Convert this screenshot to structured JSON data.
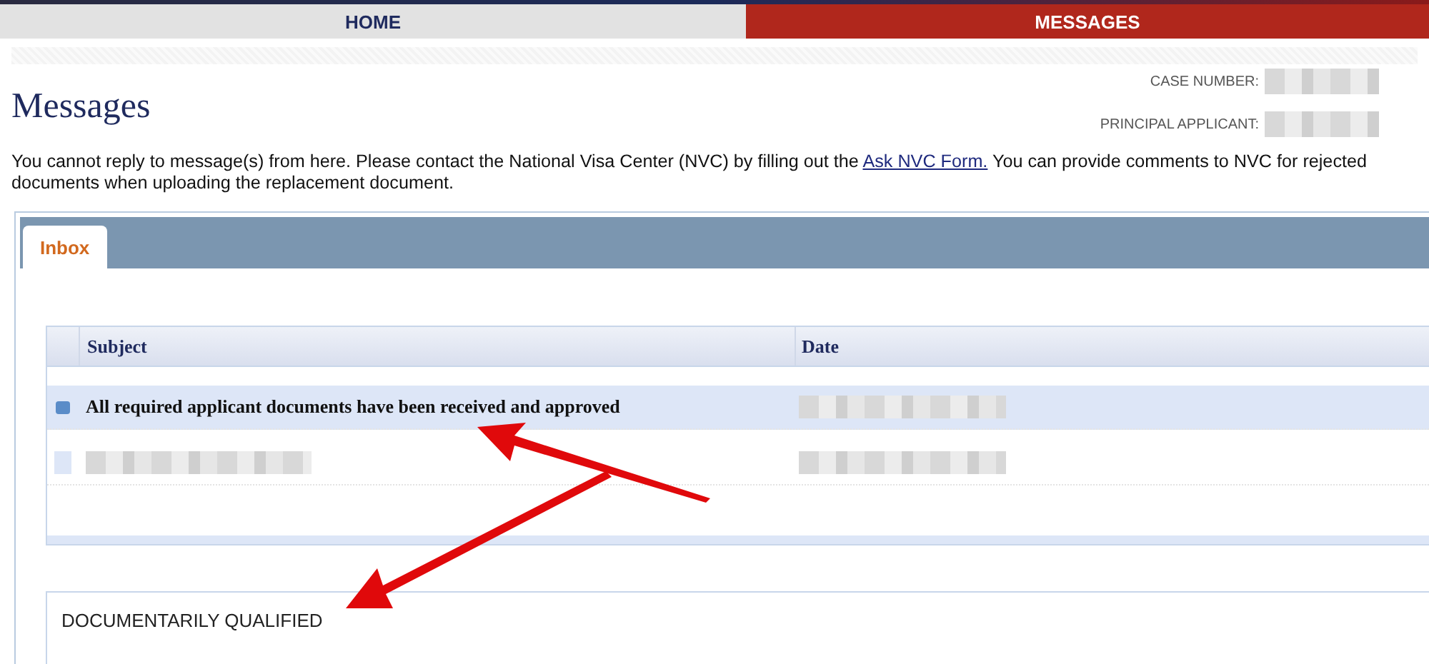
{
  "nav": [
    {
      "label": "HOME",
      "selected": false
    },
    {
      "label": "MESSAGES",
      "selected": true
    }
  ],
  "case_info": [
    {
      "label": "CASE NUMBER:",
      "kind": "redacted"
    },
    {
      "label": "PRINCIPAL APPLICANT:",
      "kind": "redacted"
    }
  ],
  "page_title": "Messages",
  "notice": {
    "before": "You cannot reply to message(s) from here.  Please contact the National Visa Center (NVC) by filling out the ",
    "link": "Ask NVC Form.",
    "after": "  You can provide comments to NVC for rejected documents when uploading the replacement document."
  },
  "tabs": [
    {
      "label": "Inbox",
      "selected": true
    }
  ],
  "table": {
    "columns": [
      "Subject",
      "Date"
    ],
    "rows": [
      {
        "kind": "text",
        "subject": "All required applicant documents have been received and approved",
        "selected": true
      },
      {
        "kind": "redacted",
        "selected": false
      }
    ]
  },
  "message_body": "DOCUMENTARILY QUALIFIED"
}
